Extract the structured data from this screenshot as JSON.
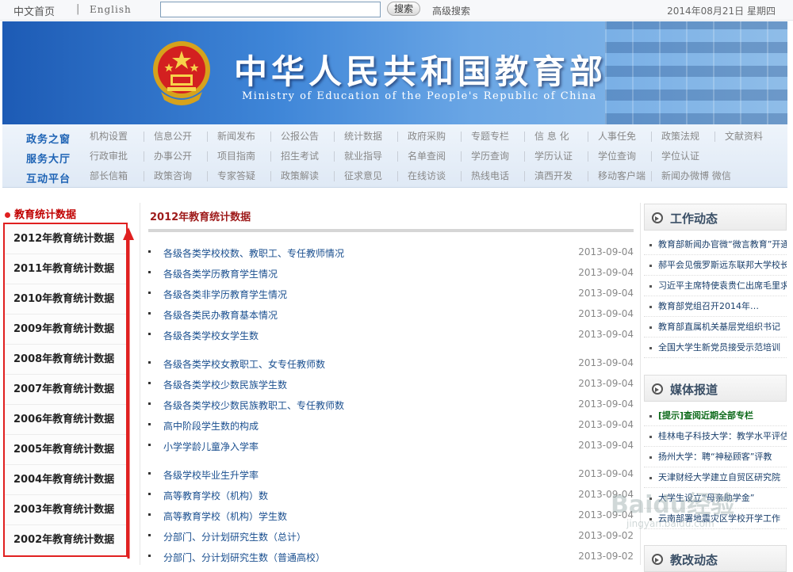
{
  "topbar": {
    "home": "中文首页",
    "sep": "|",
    "english": "English",
    "search_placeholder": "",
    "search_button": "搜索",
    "advanced": "高级搜索",
    "date": "2014年08月21日 星期四"
  },
  "banner": {
    "title_cn": "中华人民共和国教育部",
    "title_en": "Ministry of Education of the People's Republic of China"
  },
  "nav": [
    {
      "category": "政务之窗",
      "items": [
        "机构设置",
        "信息公开",
        "新闻发布",
        "公报公告",
        "统计数据",
        "政府采购",
        "专题专栏",
        "信 息 化",
        "人事任免",
        "政策法规",
        "文献资料"
      ]
    },
    {
      "category": "服务大厅",
      "items": [
        "行政审批",
        "办事公开",
        "项目指南",
        "招生考试",
        "就业指导",
        "名单查阅",
        "学历查询",
        "学历认证",
        "学位查询",
        "学位认证"
      ]
    },
    {
      "category": "互动平台",
      "items": [
        "部长信箱",
        "政策咨询",
        "专家答疑",
        "政策解读",
        "征求意见",
        "在线访谈",
        "热线电话",
        "滇西开发",
        "移动客户端",
        "新闻办微博 微信"
      ]
    }
  ],
  "sidebar": {
    "heading": "教育统计数据",
    "items": [
      "2012年教育统计数据",
      "2011年教育统计数据",
      "2010年教育统计数据",
      "2009年教育统计数据",
      "2008年教育统计数据",
      "2007年教育统计数据",
      "2006年教育统计数据",
      "2005年教育统计数据",
      "2004年教育统计数据",
      "2003年教育统计数据",
      "2002年教育统计数据"
    ]
  },
  "main": {
    "title": "2012年教育统计数据",
    "articles": [
      {
        "title": "各级各类学校校数、教职工、专任教师情况",
        "date": "2013-09-04"
      },
      {
        "title": "各级各类学历教育学生情况",
        "date": "2013-09-04"
      },
      {
        "title": "各级各类非学历教育学生情况",
        "date": "2013-09-04"
      },
      {
        "title": "各级各类民办教育基本情况",
        "date": "2013-09-04"
      },
      {
        "title": "各级各类学校女学生数",
        "date": "2013-09-04"
      },
      {
        "title": "各级各类学校女教职工、女专任教师数",
        "date": "2013-09-04"
      },
      {
        "title": "各级各类学校少数民族学生数",
        "date": "2013-09-04"
      },
      {
        "title": "各级各类学校少数民族教职工、专任教师数",
        "date": "2013-09-04"
      },
      {
        "title": "高中阶段学生数的构成",
        "date": "2013-09-04"
      },
      {
        "title": "小学学龄儿童净入学率",
        "date": "2013-09-04"
      },
      {
        "title": "各级学校毕业生升学率",
        "date": "2013-09-04"
      },
      {
        "title": "高等教育学校（机构）数",
        "date": "2013-09-04"
      },
      {
        "title": "高等教育学校（机构）学生数",
        "date": "2013-09-04"
      },
      {
        "title": "分部门、分计划研究生数（总计）",
        "date": "2013-09-02"
      },
      {
        "title": "分部门、分计划研究生数（普通高校）",
        "date": "2013-09-02"
      }
    ]
  },
  "right": {
    "work_title": "工作动态",
    "work_items": [
      "教育部新闻办官微“微言教育”开通",
      "郝平会见俄罗斯远东联邦大学校长",
      "习近平主席特使袁贵仁出席毛里求斯",
      "教育部党组召开2014年…",
      "教育部直属机关基层党组织书记",
      "全国大学生新党员接受示范培训"
    ],
    "media_title": "媒体报道",
    "media_items": [
      "[提示]查阅近期全部专栏",
      "桂林电子科技大学：教学水平评估",
      "扬州大学：聘“神秘顾客”评教",
      "天津财经大学建立自贸区研究院",
      "大学生设立“母亲助学金”",
      "云南部署地震灾区学校开学工作"
    ],
    "reform_title": "教改动态"
  },
  "watermark": {
    "brand": "Baidu经验",
    "url": "jingyan.baidu.com"
  },
  "colors": {
    "accent_red": "#c00000",
    "nav_blue": "#1f64b5",
    "banner_blue": "#2f74cc"
  }
}
